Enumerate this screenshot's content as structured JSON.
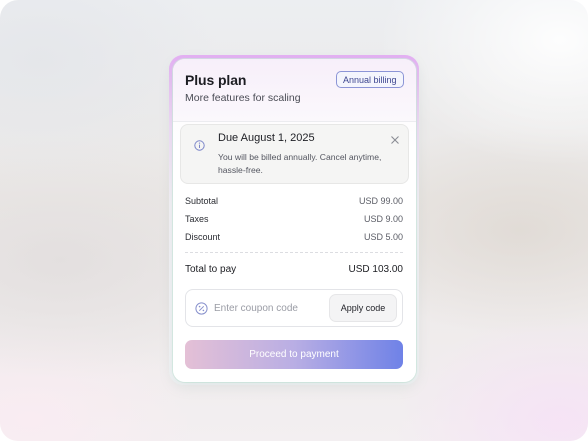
{
  "plan": {
    "title": "Plus plan",
    "subtitle": "More features for scaling",
    "billing_badge": "Annual billing"
  },
  "notice": {
    "title": "Due August 1, 2025",
    "body": "You will be billed annually. Cancel anytime, hassle-free."
  },
  "summary": {
    "rows": [
      {
        "label": "Subtotal",
        "value": "USD 99.00"
      },
      {
        "label": "Taxes",
        "value": "USD 9.00"
      },
      {
        "label": "Discount",
        "value": "USD 5.00"
      }
    ],
    "total_label": "Total to pay",
    "total_value": "USD 103.00"
  },
  "coupon": {
    "placeholder": "Enter coupon code",
    "apply_label": "Apply code"
  },
  "pay_label": "Proceed to payment",
  "icons": {
    "info": "info-icon",
    "close": "close-icon",
    "coupon": "coupon-icon"
  },
  "colors": {
    "accent": "#6f82e7",
    "badge_border": "#8c95d6"
  }
}
